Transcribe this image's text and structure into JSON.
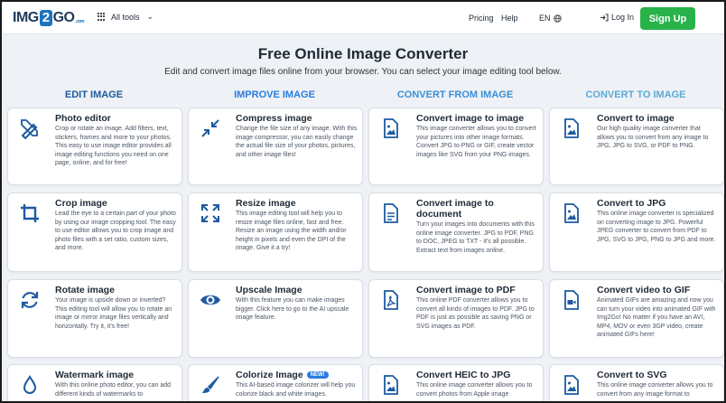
{
  "header": {
    "logo": {
      "left": "IMG",
      "mid": "2",
      "right": "GO",
      "small": ".com"
    },
    "all_tools": "All tools",
    "pricing": "Pricing",
    "help": "Help",
    "language": "EN",
    "login": "Log In",
    "signup": "Sign Up"
  },
  "hero": {
    "title": "Free Online Image Converter",
    "subtitle": "Edit and convert image files online from your browser. You can select your image editing tool below."
  },
  "columns": [
    {
      "heading": "EDIT IMAGE",
      "color": "#1e5aa0"
    },
    {
      "heading": "IMPROVE IMAGE",
      "color": "#2a7ce0"
    },
    {
      "heading": "CONVERT FROM IMAGE",
      "color": "#3a8fd6"
    },
    {
      "heading": "CONVERT TO IMAGE",
      "color": "#5aaad8"
    }
  ],
  "cards": {
    "c0r0": {
      "title": "Photo editor",
      "desc": "Crop or rotate an image. Add filters, text, stickers, frames and more to your photos. This easy to use image editor provides all image editing functions you need on one page, online, and for free!",
      "icon": "edit-tools-icon"
    },
    "c0r1": {
      "title": "Crop image",
      "desc": "Lead the eye to a certain part of your photo by using our image cropping tool. The easy to use editor allows you to crop image and photo files with a set ratio, custom sizes, and more.",
      "icon": "crop-icon"
    },
    "c0r2": {
      "title": "Rotate image",
      "desc": "Your image is upside down or inverted? This editing tool will allow you to rotate an image or mirror image files vertically and horizontally. Try it, it's free!",
      "icon": "rotate-icon"
    },
    "c0r3": {
      "title": "Watermark image",
      "desc": "With this online photo editor, you can add different kinds of watermarks to",
      "icon": "droplet-icon"
    },
    "c1r0": {
      "title": "Compress image",
      "desc": "Change the file size of any image. With this image compressor, you can easily change the actual file size of your photos, pictures, and other image files!",
      "icon": "compress-icon"
    },
    "c1r1": {
      "title": "Resize image",
      "desc": "This image editing tool will help you to resize image files online, fast and free. Resize an image using the width and/or height in pixels and even the DPI of the image. Give it a try!",
      "icon": "expand-icon"
    },
    "c1r2": {
      "title": "Upscale Image",
      "desc": "With this feature you can make images bigger. Click here to go to the AI upscale image feature.",
      "icon": "eye-icon"
    },
    "c1r3": {
      "title": "Colorize Image",
      "badge": "NEW!",
      "desc": "This AI-based image colorizer will help you colorize black and white images.",
      "icon": "brush-icon"
    },
    "c2r0": {
      "title": "Convert image to image",
      "desc": "This image converter allows you to convert your pictures into other image formats. Convert JPG to PNG or GIF, create vector images like SVG from your PNG images.",
      "icon": "image-file-icon"
    },
    "c2r1": {
      "title": "Convert image to",
      "title2": "document",
      "desc": "Turn your images into documents with this online image converter. JPG to PDF, PNG to DOC, JPEG to TXT - it's all possible. Extract text from images online.",
      "icon": "document-icon"
    },
    "c2r2": {
      "title": "Convert image to PDF",
      "desc": "This online PDF converter allows you to convert all kinds of images to PDF. JPG to PDF is just as possible as saving PNG or SVG images as PDF.",
      "icon": "pdf-icon"
    },
    "c2r3": {
      "title": "Convert HEIC to JPG",
      "desc": "This online image converter allows you to convert photos from Apple image",
      "icon": "image-file-icon"
    },
    "c3r0": {
      "title": "Convert to image",
      "desc": "Our high quality image converter that allows you to convert from any image to JPG, JPG to SVG, or PDF to PNG.",
      "icon": "image-file-icon"
    },
    "c3r1": {
      "title": "Convert to JPG",
      "desc": "This online image converter is specialized on converting image to JPG. Powerful JPEG converter to convert from PDF to JPG, SVG to JPG, PNG to JPG and more.",
      "icon": "image-file-icon"
    },
    "c3r2": {
      "title": "Convert video to GIF",
      "desc": "Animated GIFs are amazing and now you can turn your video into animated GIF with Img2Go! No matter if you have an AVI, MP4, MOV or even 3GP video, create animated GIFs here!",
      "icon": "video-file-icon"
    },
    "c3r3": {
      "title": "Convert to SVG",
      "desc": "This online image converter allows you to convert from any image format to",
      "icon": "image-file-icon"
    }
  },
  "colors": {
    "accent": "#1e73be",
    "signup": "#27b34a",
    "icon": "#1e5aa0"
  }
}
